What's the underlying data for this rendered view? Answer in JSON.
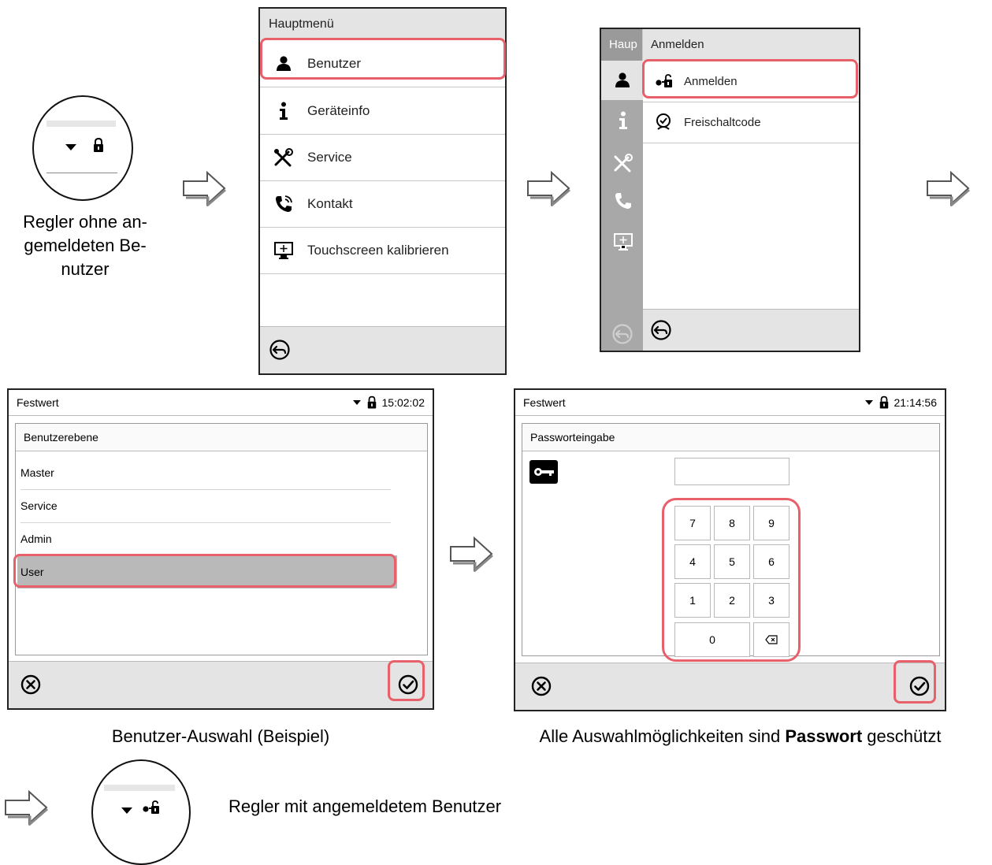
{
  "step1": {
    "caption_lines": [
      "Regler ohne an-",
      "gemeldeten Be-",
      "nutzer"
    ]
  },
  "main_menu": {
    "title": "Hauptmenü",
    "items": [
      {
        "label": "Benutzer",
        "icon": "user-icon"
      },
      {
        "label": "Geräteinfo",
        "icon": "info-icon"
      },
      {
        "label": "Service",
        "icon": "tools-icon"
      },
      {
        "label": "Kontakt",
        "icon": "phone-icon"
      },
      {
        "label": "Touchscreen kalibrieren",
        "icon": "touchscreen-icon"
      }
    ],
    "back_icon": "back-icon"
  },
  "login_menu": {
    "sidebar_title": "Haup",
    "title": "Anmelden",
    "items": [
      {
        "label": "Anmelden",
        "icon": "login-icon"
      },
      {
        "label": "Freischaltcode",
        "icon": "unlock-code-icon"
      }
    ]
  },
  "user_select": {
    "mode": "Festwert",
    "time": "15:02:02",
    "panel_title": "Benutzerebene",
    "users": [
      "Master",
      "Service",
      "Admin",
      "User"
    ],
    "selected": "User",
    "caption": "Benutzer-Auswahl (Beispiel)"
  },
  "password": {
    "mode": "Festwert",
    "time": "21:14:56",
    "panel_title": "Passworteingabe",
    "keys": [
      "7",
      "8",
      "9",
      "4",
      "5",
      "6",
      "1",
      "2",
      "3",
      "0"
    ],
    "caption_pre": "Alle Auswahlmöglichkeiten sind ",
    "caption_bold": "Passwort",
    "caption_post": " geschützt"
  },
  "result": {
    "caption": "Regler mit angemeldetem Benutzer"
  },
  "colors": {
    "highlight": "#e8606a",
    "selected_row": "#b9b9b9",
    "bar": "#e4e4e4",
    "sidebar": "#a8a8a8"
  }
}
